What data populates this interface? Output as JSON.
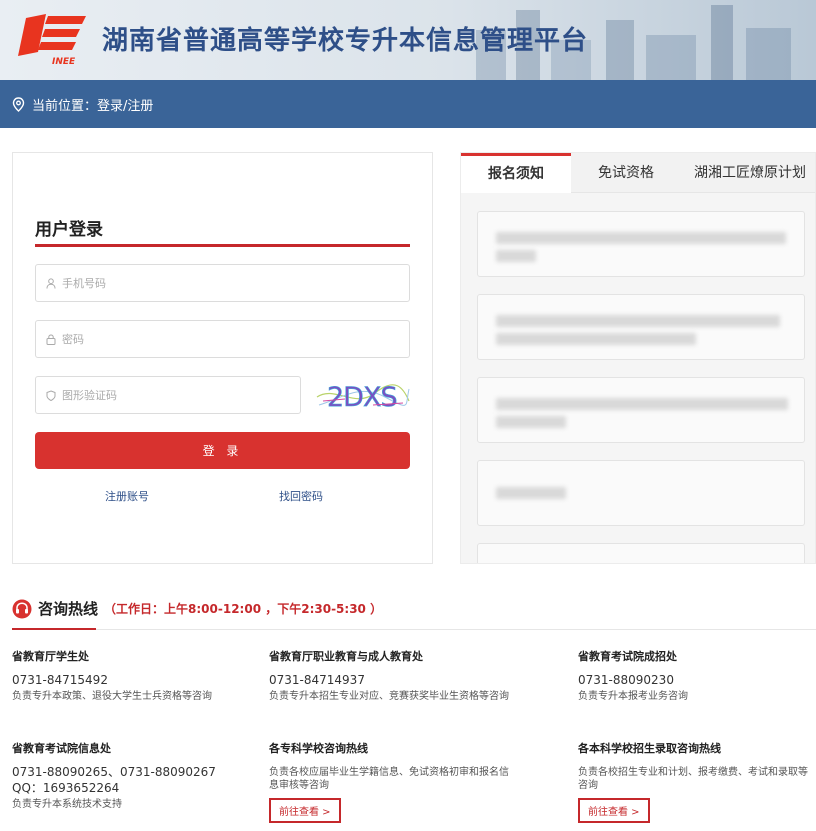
{
  "header": {
    "title": "湖南省普通高等学校专升本信息管理平台"
  },
  "location": {
    "text": "当前位置：登录/注册"
  },
  "login": {
    "title": "用户登录",
    "phone_placeholder": "手机号码",
    "password_placeholder": "密码",
    "captcha_placeholder": "图形验证码",
    "captcha_text": "2DXS",
    "submit_label": "登 录",
    "register_link": "注册账号",
    "recover_link": "找回密码"
  },
  "tabs": [
    "报名须知",
    "免试资格",
    "湖湘工匠燎原计划"
  ],
  "hotline": {
    "title": "咨询热线",
    "hours": "（工作日：上午8:00-12:00 ，下午2:30-5:30 ）",
    "contacts": [
      {
        "name": "省教育厅学生处",
        "numbers": [
          "0731-84715492"
        ],
        "desc": "负责专升本政策、退役大学生士兵资格等咨询"
      },
      {
        "name": "省教育厅职业教育与成人教育处",
        "numbers": [
          "0731-84714937"
        ],
        "desc": "负责专升本招生专业对应、竞赛获奖毕业生资格等咨询"
      },
      {
        "name": "省教育考试院成招处",
        "numbers": [
          "0731-88090230"
        ],
        "desc": "负责专升本报考业务咨询"
      },
      {
        "name": "省教育考试院信息处",
        "numbers": [
          "0731-88090265、0731-88090267",
          "QQ：1693652264"
        ],
        "desc": "负责专升本系统技术支持"
      },
      {
        "name": "各专科学校咨询热线",
        "numbers": [],
        "desc": "负责各校应届毕业生学籍信息、免试资格初审和报名信息审核等咨询",
        "link": "前往查看 >"
      },
      {
        "name": "各本科学校招生录取咨询热线",
        "numbers": [],
        "desc": "负责各校招生专业和计划、报考缴费、考试和录取等咨询",
        "link": "前往查看 >"
      }
    ]
  },
  "colors": {
    "brand_blue": "#3a6498",
    "accent_red": "#d8322f"
  }
}
